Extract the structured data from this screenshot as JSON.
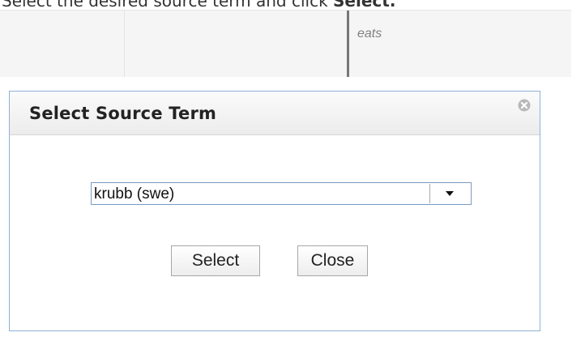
{
  "instruction": {
    "text_prefix": "Select the desired source term and click ",
    "text_bold": "Select."
  },
  "table": {
    "cells": [
      "",
      "",
      "eats"
    ]
  },
  "dialog": {
    "title": "Select Source Term",
    "dropdown": {
      "selected": "krubb (swe)"
    },
    "buttons": {
      "select_label": "Select",
      "close_label": "Close"
    }
  },
  "colors": {
    "dialog_border": "#8db2d6",
    "header_background": "#ececec",
    "divider": "#777777"
  },
  "icons": {
    "close": "close-icon",
    "dropdown": "chevron-down-icon"
  }
}
